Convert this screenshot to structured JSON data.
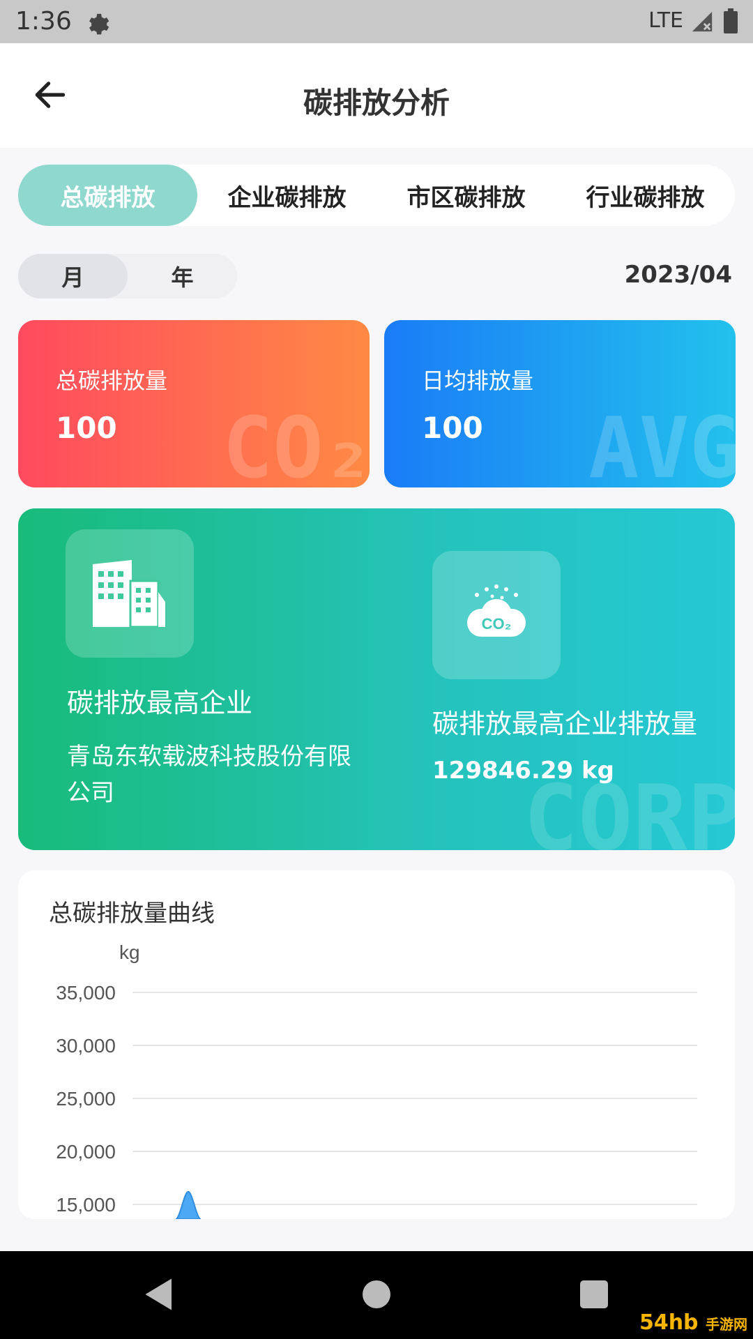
{
  "status_bar": {
    "time": "1:36",
    "network": "LTE"
  },
  "header": {
    "title": "碳排放分析"
  },
  "tabs": [
    {
      "label": "总碳排放",
      "active": true
    },
    {
      "label": "企业碳排放",
      "active": false
    },
    {
      "label": "市区碳排放",
      "active": false
    },
    {
      "label": "行业碳排放",
      "active": false
    }
  ],
  "period": {
    "month_label": "月",
    "year_label": "年",
    "selected": "月",
    "date": "2023/04"
  },
  "stats": {
    "total": {
      "label": "总碳排放量",
      "value": "100",
      "watermark": "CO₂"
    },
    "daily": {
      "label": "日均排放量",
      "value": "100",
      "watermark": "AVG"
    }
  },
  "top_company": {
    "label": "碳排放最高企业",
    "name": "青岛东软载波科技股份有限公司",
    "emission_label": "碳排放最高企业排放量",
    "emission_value": "129846.29 kg",
    "watermark": "CORP",
    "icon_text": "CO₂"
  },
  "chart_data": {
    "type": "area",
    "title": "总碳排放量曲线",
    "ylabel": "kg",
    "ylim": [
      15000,
      35000
    ],
    "y_ticks": [
      "35,000",
      "30,000",
      "25,000",
      "20,000",
      "15,000"
    ],
    "grid": true,
    "series": [
      {
        "values": [
          16200
        ]
      }
    ],
    "colors": {
      "series": "#4aa8f5",
      "grid": "#e6e6e6",
      "tick": "#555555"
    }
  },
  "nav": {
    "site_badge": "54hb",
    "site_badge_small": "手游网"
  },
  "colors": {
    "accent_tab": "#8fd8ce",
    "red_card": "#ff4a5e",
    "blue_card": "#1a7cf7",
    "green_card": "#18bb7a"
  }
}
